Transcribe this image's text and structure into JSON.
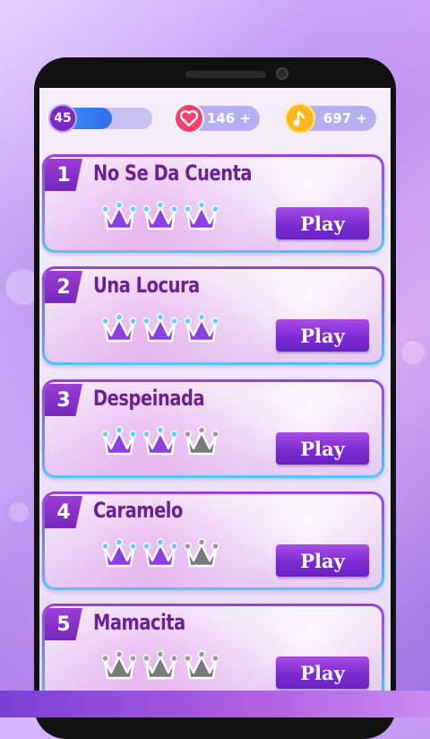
{
  "topbar": {
    "level": "45",
    "level_progress": 0.55,
    "lives": "146 +",
    "coins": "697 +",
    "lives_icon": "heart-icon",
    "coins_icon": "music-note-icon"
  },
  "songs": [
    {
      "number": "1",
      "title": "No Se Da Cuenta",
      "crowns_earned": 3,
      "crowns_total": 3,
      "play_label": "Play"
    },
    {
      "number": "2",
      "title": "Una Locura",
      "crowns_earned": 3,
      "crowns_total": 3,
      "play_label": "Play"
    },
    {
      "number": "3",
      "title": "Despeinada",
      "crowns_earned": 2,
      "crowns_total": 3,
      "play_label": "Play"
    },
    {
      "number": "4",
      "title": "Caramelo",
      "crowns_earned": 2,
      "crowns_total": 3,
      "play_label": "Play"
    },
    {
      "number": "5",
      "title": "Mamacita",
      "crowns_earned": 0,
      "crowns_total": 3,
      "play_label": "Play"
    }
  ],
  "colors": {
    "accent": "#7b2bd3",
    "title_text": "#6a2293",
    "crown_earned": "#8b3fe0",
    "crown_empty": "#7a7a7a",
    "heart": "#ff3d6e",
    "coin": "#ffb81c"
  }
}
